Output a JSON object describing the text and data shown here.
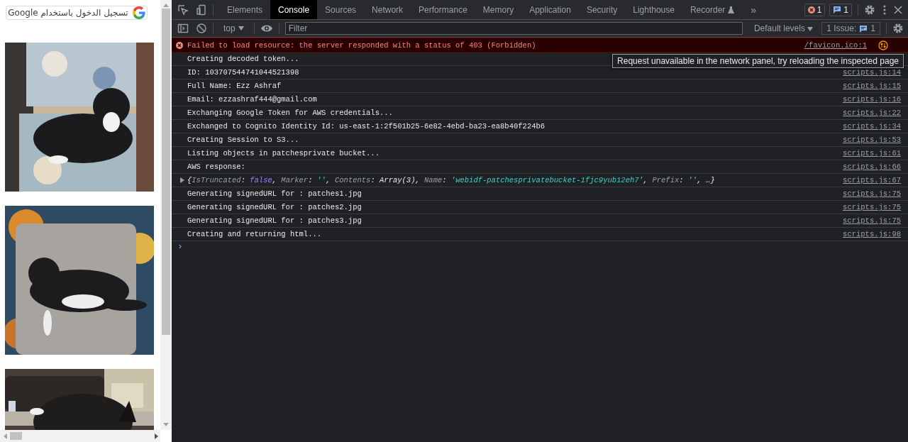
{
  "page": {
    "signin_button": {
      "label": "تسجيل الدخول باستخدام Google"
    }
  },
  "devtools": {
    "tabs": [
      {
        "label": "Elements",
        "selected": false
      },
      {
        "label": "Console",
        "selected": true
      },
      {
        "label": "Sources",
        "selected": false
      },
      {
        "label": "Network",
        "selected": false
      },
      {
        "label": "Performance",
        "selected": false
      },
      {
        "label": "Memory",
        "selected": false
      },
      {
        "label": "Application",
        "selected": false
      },
      {
        "label": "Security",
        "selected": false
      },
      {
        "label": "Lighthouse",
        "selected": false
      },
      {
        "label": "Recorder",
        "selected": false,
        "experimental": true
      }
    ],
    "more_tabs": "»",
    "error_count": "1",
    "message_count": "1",
    "toolbar": {
      "context": "top",
      "filter_placeholder": "Filter",
      "levels": "Default levels",
      "issues_label": "1 Issue:",
      "issues_count": "1"
    },
    "messages": [
      {
        "kind": "error",
        "text": "Failed to load resource: the server responded with a status of 403 (Forbidden)",
        "source": "/favicon.ico:1"
      },
      {
        "kind": "log",
        "text": "Creating decoded token..."
      },
      {
        "kind": "log",
        "text": "ID: 103707544741044521398",
        "source": "scripts.js:14"
      },
      {
        "kind": "log",
        "text": "Full Name: Ezz Ashraf",
        "source": "scripts.js:15"
      },
      {
        "kind": "log",
        "text": "Email: ezzashraf444@gmail.com",
        "source": "scripts.js:16"
      },
      {
        "kind": "log",
        "text": "Exchanging Google Token for AWS credentials...",
        "source": "scripts.js:22"
      },
      {
        "kind": "log",
        "text": "Exchanged to Cognito Identity Id: us-east-1:2f501b25-6e82-4ebd-ba23-ea8b40f224b6",
        "source": "scripts.js:34"
      },
      {
        "kind": "log",
        "text": "Creating Session to S3...",
        "source": "scripts.js:53"
      },
      {
        "kind": "log",
        "text": "Listing objects in patchesprivate bucket...",
        "source": "scripts.js:61"
      },
      {
        "kind": "log",
        "text": "AWS response:",
        "source": "scripts.js:66"
      },
      {
        "kind": "object",
        "tokens": [
          {
            "kind": "punct",
            "text": "{"
          },
          {
            "kind": "key",
            "text": "IsTruncated"
          },
          {
            "kind": "punct",
            "text": ": "
          },
          {
            "kind": "boolean",
            "text": "false"
          },
          {
            "kind": "punct",
            "text": ", "
          },
          {
            "kind": "key",
            "text": "Marker"
          },
          {
            "kind": "punct",
            "text": ": "
          },
          {
            "kind": "string",
            "text": "''"
          },
          {
            "kind": "punct",
            "text": ", "
          },
          {
            "kind": "key",
            "text": "Contents"
          },
          {
            "kind": "punct",
            "text": ": "
          },
          {
            "kind": "object",
            "text": "Array(3)"
          },
          {
            "kind": "punct",
            "text": ", "
          },
          {
            "kind": "key",
            "text": "Name"
          },
          {
            "kind": "punct",
            "text": ": "
          },
          {
            "kind": "string",
            "text": "'webidf-patchesprivatebucket-1fjc9yub12eh7'"
          },
          {
            "kind": "punct",
            "text": ", "
          },
          {
            "kind": "key",
            "text": "Prefix"
          },
          {
            "kind": "punct",
            "text": ": "
          },
          {
            "kind": "string",
            "text": "''"
          },
          {
            "kind": "punct",
            "text": ", …}"
          }
        ],
        "expanded": false,
        "source": "scripts.js:67"
      },
      {
        "kind": "log",
        "text": "Generating signedURL for : patches1.jpg",
        "source": "scripts.js:75"
      },
      {
        "kind": "log",
        "text": "Generating signedURL for : patches2.jpg",
        "source": "scripts.js:75"
      },
      {
        "kind": "log",
        "text": "Generating signedURL for : patches3.jpg",
        "source": "scripts.js:75"
      },
      {
        "kind": "log",
        "text": "Creating and returning html...",
        "source": "scripts.js:98"
      }
    ],
    "prompt": "›",
    "tooltip": "Request unavailable in the network panel, try reloading the inspected page"
  }
}
